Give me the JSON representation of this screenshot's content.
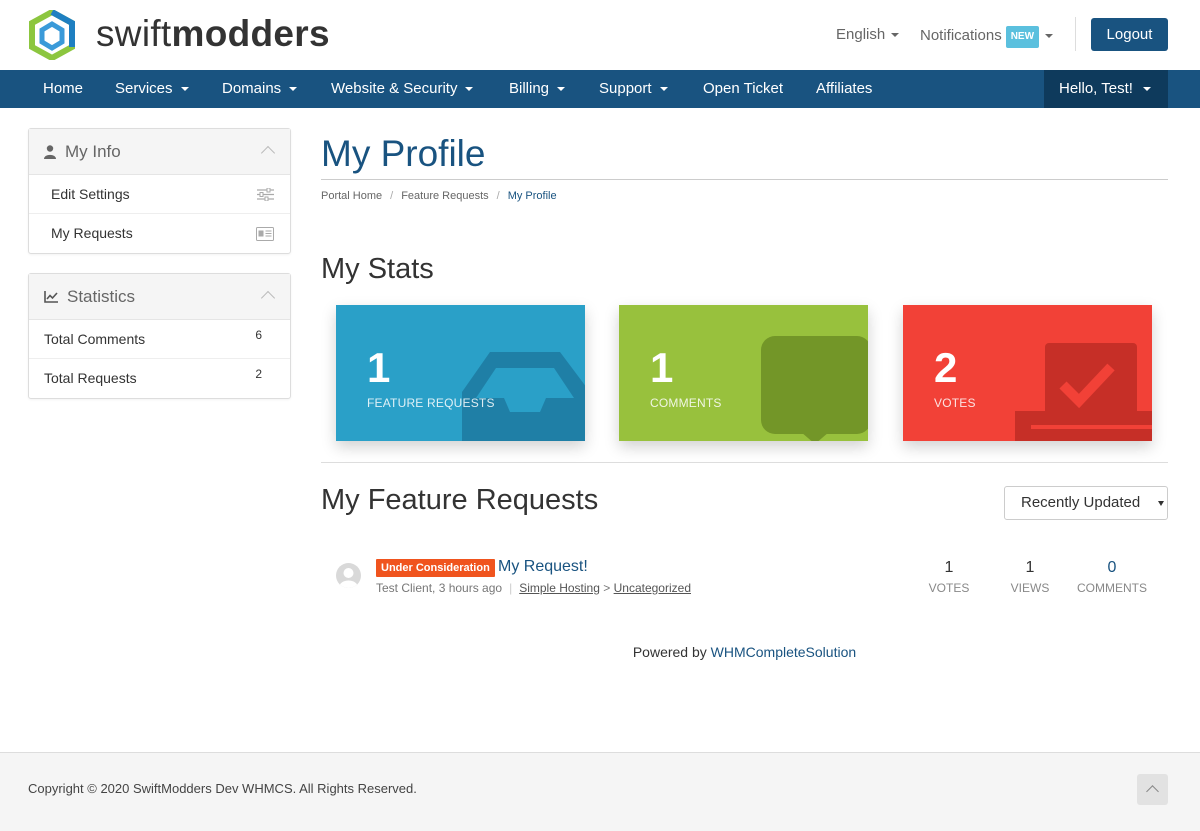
{
  "colors": {
    "primary": "#195380",
    "nav_dark": "#0e3a5c",
    "stat_blue": "#2aa0c8",
    "stat_green": "#98c13d",
    "stat_red": "#f24137",
    "status_orange": "#f0541e",
    "badge_new": "#5bc0de",
    "logo_green": "#8cc63f"
  },
  "header": {
    "brand_light": "swift",
    "brand_bold": "modders",
    "language": "English",
    "notifications": "Notifications",
    "notifications_badge": "NEW",
    "logout": "Logout"
  },
  "nav": {
    "items": [
      {
        "label": "Home"
      },
      {
        "label": "Services"
      },
      {
        "label": "Domains"
      },
      {
        "label": "Website & Security"
      },
      {
        "label": "Billing"
      },
      {
        "label": "Support"
      },
      {
        "label": "Open Ticket"
      },
      {
        "label": "Affiliates"
      }
    ],
    "account": "Hello, Test!"
  },
  "sidebar": {
    "my_info": {
      "title": "My Info",
      "items": [
        {
          "label": "Edit Settings",
          "icon": "sliders-icon"
        },
        {
          "label": "My Requests",
          "icon": "id-card-icon"
        }
      ]
    },
    "statistics": {
      "title": "Statistics",
      "items": [
        {
          "label": "Total Comments",
          "count": "6"
        },
        {
          "label": "Total Requests",
          "count": "2"
        }
      ]
    }
  },
  "main": {
    "title": "My Profile",
    "breadcrumbs": [
      "Portal Home",
      "Feature Requests",
      "My Profile"
    ],
    "stats_heading": "My Stats",
    "stats": [
      {
        "value": "1",
        "label": "FEATURE REQUESTS",
        "icon": "inbox-icon"
      },
      {
        "value": "1",
        "label": "COMMENTS",
        "icon": "comment-icon"
      },
      {
        "value": "2",
        "label": "VOTES",
        "icon": "vote-check-icon"
      }
    ],
    "requests_heading": "My Feature Requests",
    "sort_selected": "Recently Updated",
    "requests": [
      {
        "status": "Under Consideration",
        "title": "My Request!",
        "author_time": "Test Client, 3 hours ago",
        "category_parent": "Simple Hosting",
        "category_arrow": ">",
        "category_child": "Uncategorized",
        "votes": "1",
        "votes_label": "VOTES",
        "views": "1",
        "views_label": "VIEWS",
        "comments": "0",
        "comments_label": "COMMENTS"
      }
    ],
    "powered_prefix": "Powered by",
    "powered_link": "WHMCompleteSolution"
  },
  "footer": {
    "copyright": "Copyright © 2020 SwiftModders Dev WHMCS. All Rights Reserved."
  }
}
